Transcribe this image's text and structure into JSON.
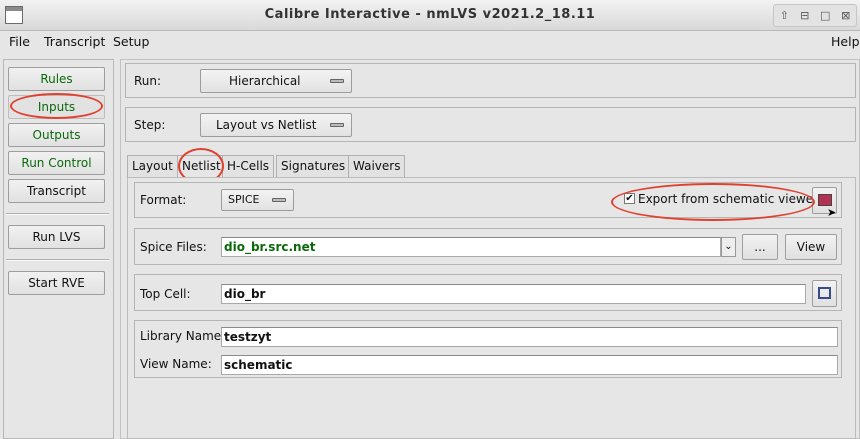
{
  "window": {
    "title": "Calibre Interactive - nmLVS v2021.2_18.11",
    "controls": [
      "up-icon",
      "minimize-icon",
      "maximize-icon",
      "close-icon"
    ]
  },
  "menubar": {
    "file": "File",
    "transcript": "Transcript",
    "setup": "Setup",
    "help": "Help"
  },
  "sidebar": {
    "rules": "Rules",
    "inputs": "Inputs",
    "outputs": "Outputs",
    "run_control": "Run Control",
    "transcript": "Transcript",
    "run_lvs": "Run LVS",
    "start_rve": "Start RVE"
  },
  "run": {
    "label": "Run:",
    "value": "Hierarchical"
  },
  "step": {
    "label": "Step:",
    "value": "Layout vs Netlist"
  },
  "tabs": [
    "Layout",
    "Netlist",
    "H-Cells",
    "Signatures",
    "Waivers"
  ],
  "netlist": {
    "format_label": "Format:",
    "format_value": "SPICE",
    "export_checked": true,
    "export_label": "Export from schematic viewer",
    "spice_label": "Spice Files:",
    "spice_value": "dio_br.src.net",
    "browse_label": "...",
    "view_label": "View",
    "topcell_label": "Top Cell:",
    "topcell_value": "dio_br",
    "library_label": "Library Name:",
    "library_value": "testzyt",
    "viewname_label": "View Name:",
    "viewname_value": "schematic"
  },
  "colors": {
    "accent_green": "#0a6a0a",
    "annotation_red": "#e0412f",
    "background": "#e6e6e6"
  }
}
